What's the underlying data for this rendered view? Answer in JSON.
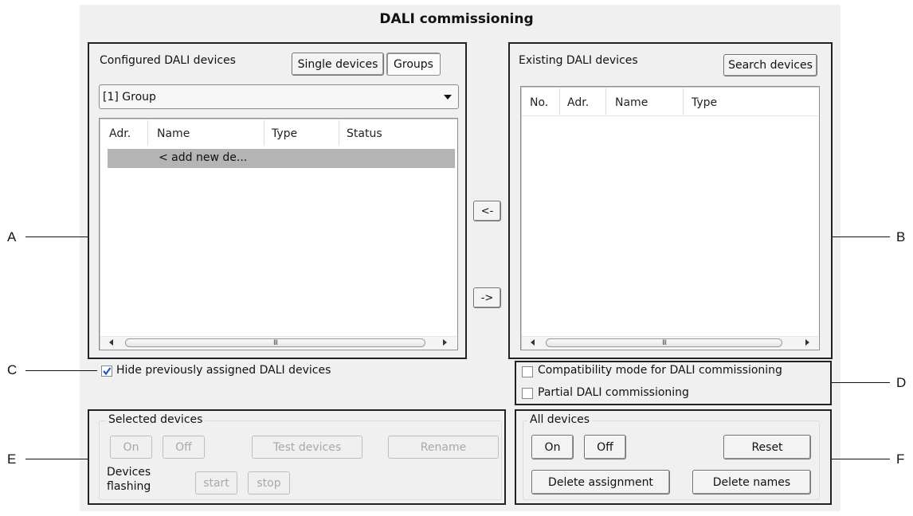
{
  "dialog_title": "DALI commissioning",
  "configured": {
    "heading": "Configured DALI devices",
    "single_devices_label": "Single devices",
    "groups_label": "Groups",
    "dropdown_value": "[1] Group",
    "columns": [
      "Adr.",
      "Name",
      "Type",
      "Status"
    ],
    "rows": [
      {
        "adr": "",
        "name": "< add new de...",
        "type": "",
        "status": ""
      }
    ],
    "scroll_thumb": "III"
  },
  "transfer": {
    "to_configured_label": "<-",
    "to_existing_label": "->"
  },
  "existing": {
    "heading": "Existing DALI devices",
    "search_label": "Search devices",
    "columns": [
      "No.",
      "Adr.",
      "Name",
      "Type"
    ],
    "scroll_thumb": "III"
  },
  "options": {
    "hide_assigned": {
      "label": "Hide previously assigned DALI devices",
      "checked": true
    },
    "compatibility_mode": {
      "label": "Compatibility mode for DALI commissioning",
      "checked": false
    },
    "partial_commissioning": {
      "label": "Partial DALI commissioning",
      "checked": false
    }
  },
  "selected_devices": {
    "title": "Selected devices",
    "on_label": "On",
    "off_label": "Off",
    "test_label": "Test devices",
    "rename_label": "Rename",
    "flashing_label_1": "Devices",
    "flashing_label_2": "flashing",
    "start_label": "start",
    "stop_label": "stop"
  },
  "all_devices": {
    "title": "All devices",
    "on_label": "On",
    "off_label": "Off",
    "reset_label": "Reset",
    "delete_assignment_label": "Delete assignment",
    "delete_names_label": "Delete names"
  },
  "callouts": {
    "a": "A",
    "b": "B",
    "c": "C",
    "d": "D",
    "e": "E",
    "f": "F"
  },
  "colors": {
    "selection_row": "#b4b4b4",
    "check_mark": "#1a56c8",
    "frame": "#222222"
  }
}
